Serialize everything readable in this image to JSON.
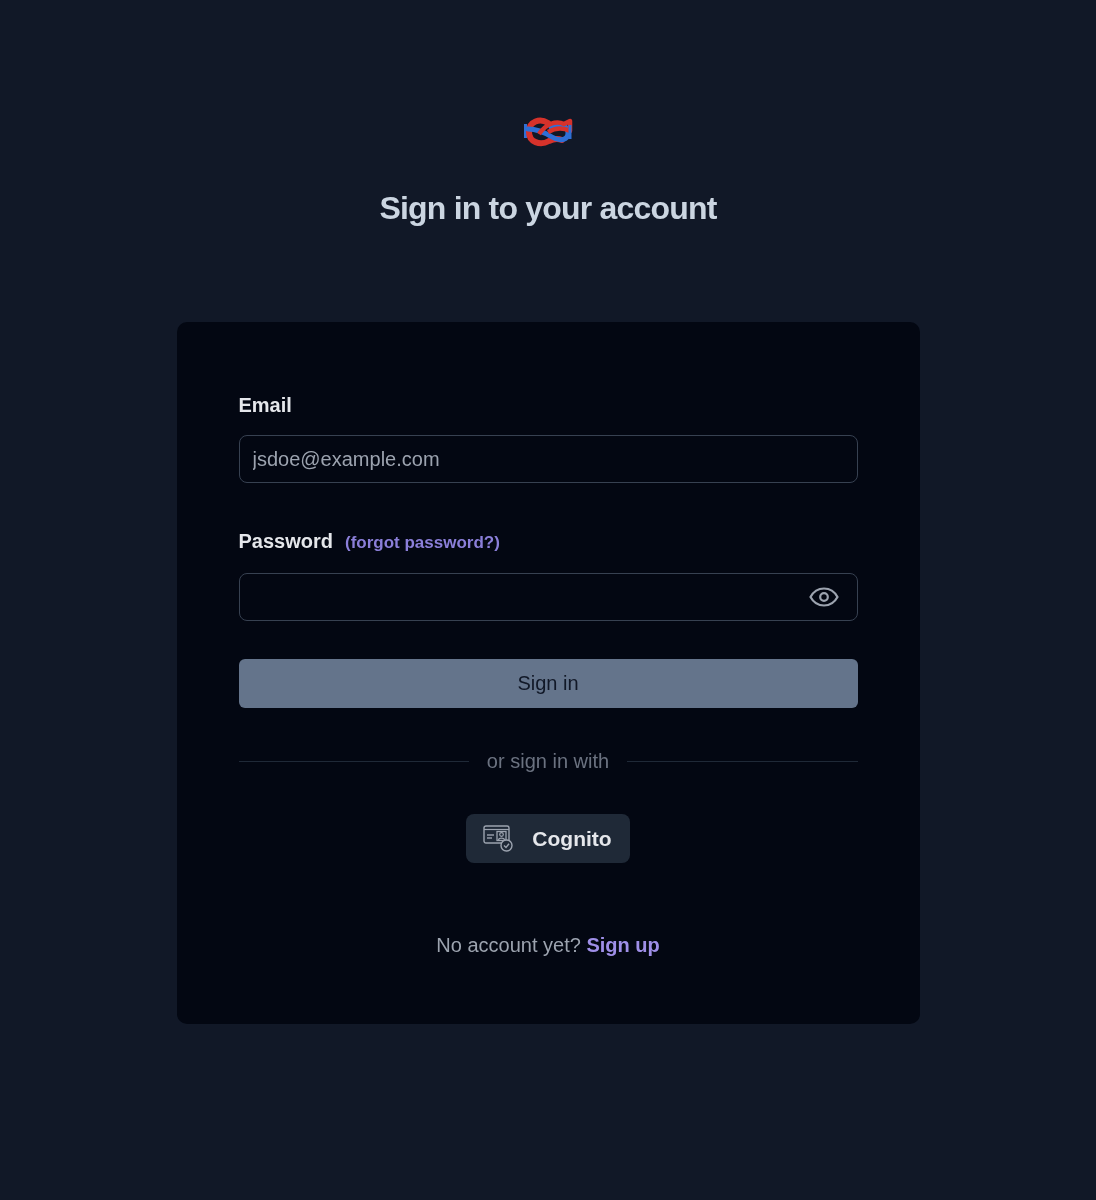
{
  "heading": "Sign in to your account",
  "email": {
    "label": "Email",
    "placeholder": "jsdoe@example.com"
  },
  "password": {
    "label": "Password",
    "forgot_link": "(forgot password?)"
  },
  "submit": {
    "label": "Sign in",
    "disabled": true
  },
  "divider": "or sign in with",
  "providers": [
    {
      "label": "Cognito"
    }
  ],
  "signup": {
    "prompt": "No account yet?",
    "link": "Sign up"
  }
}
